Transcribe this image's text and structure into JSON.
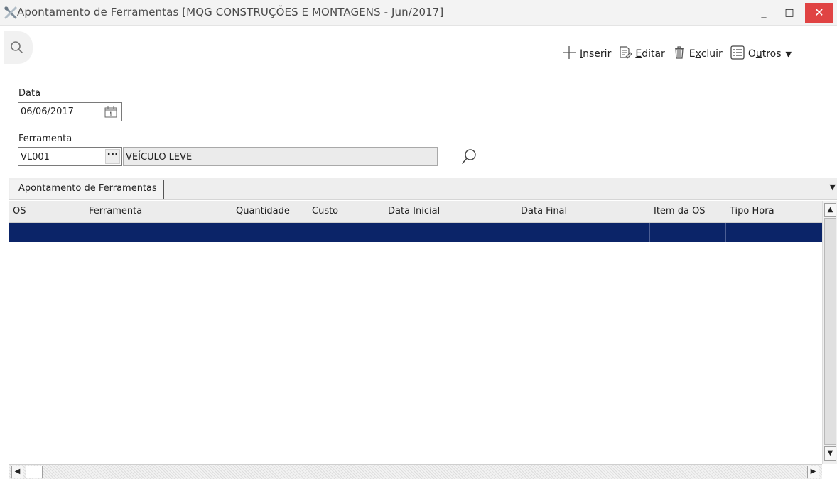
{
  "window": {
    "title": "Apontamento de Ferramentas [MQG CONSTRUÇÕES E MONTAGENS - Jun/2017]",
    "minimize": "_",
    "maximize": "□",
    "close": "✕"
  },
  "toolbar": {
    "insert": {
      "pre": "",
      "u": "I",
      "post": "nserir"
    },
    "edit": {
      "pre": "",
      "u": "E",
      "post": "ditar"
    },
    "delete": {
      "pre": "E",
      "u": "x",
      "post": "cluir"
    },
    "other": {
      "pre": "O",
      "u": "u",
      "post": "tros"
    }
  },
  "form": {
    "data_label": "Data",
    "data_value": "06/06/2017",
    "ferramenta_label": "Ferramenta",
    "ferramenta_code": "VL001",
    "ferramenta_desc": "VEÍCULO LEVE",
    "lookup_button": "···"
  },
  "tabs": [
    {
      "label": "Apontamento de Ferramentas"
    }
  ],
  "grid": {
    "columns": [
      "OS",
      "Ferramenta",
      "Quantidade",
      "Custo",
      "Data Inicial",
      "Data Final",
      "Item da OS",
      "Tipo Hora"
    ]
  },
  "colors": {
    "selected_row": "#0b2468",
    "close_button": "#e04343"
  },
  "icons": [
    "tools-icon",
    "search-icon",
    "plus-icon",
    "edit-icon",
    "trash-icon",
    "list-icon",
    "calendar-icon",
    "magnifier-icon"
  ]
}
